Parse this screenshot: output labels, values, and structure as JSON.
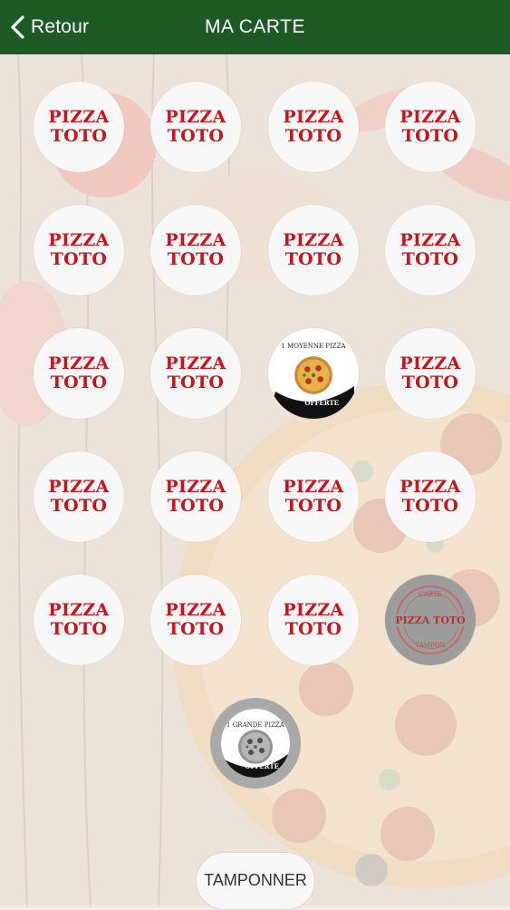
{
  "header": {
    "back_label": "Retour",
    "title": "MA CARTE",
    "background_color": "#1e5a26"
  },
  "stamps": {
    "brand_line1": "PIZZA",
    "brand_line2": "TOTO",
    "brand_color": "#c8151b",
    "rows": [
      [
        "logo",
        "logo",
        "logo",
        "logo"
      ],
      [
        "logo",
        "logo",
        "logo",
        "logo"
      ],
      [
        "logo",
        "logo",
        "reward-medium",
        "logo"
      ],
      [
        "logo",
        "logo",
        "logo",
        "logo"
      ],
      [
        "logo",
        "logo",
        "logo",
        "stamped"
      ],
      [
        "reward-large"
      ]
    ]
  },
  "rewards": {
    "medium_text": "1 MOYENNE PIZZA",
    "medium_offer": "OFFERTE",
    "large_text": "1 GRANDE PIZZA",
    "large_offer": "OFFERTE"
  },
  "stamped_seal": {
    "top": "CARTE",
    "main": "PIZZA TOTO",
    "bottom": "TAMPON"
  },
  "action": {
    "stamp_button_label": "TAMPONNER"
  }
}
